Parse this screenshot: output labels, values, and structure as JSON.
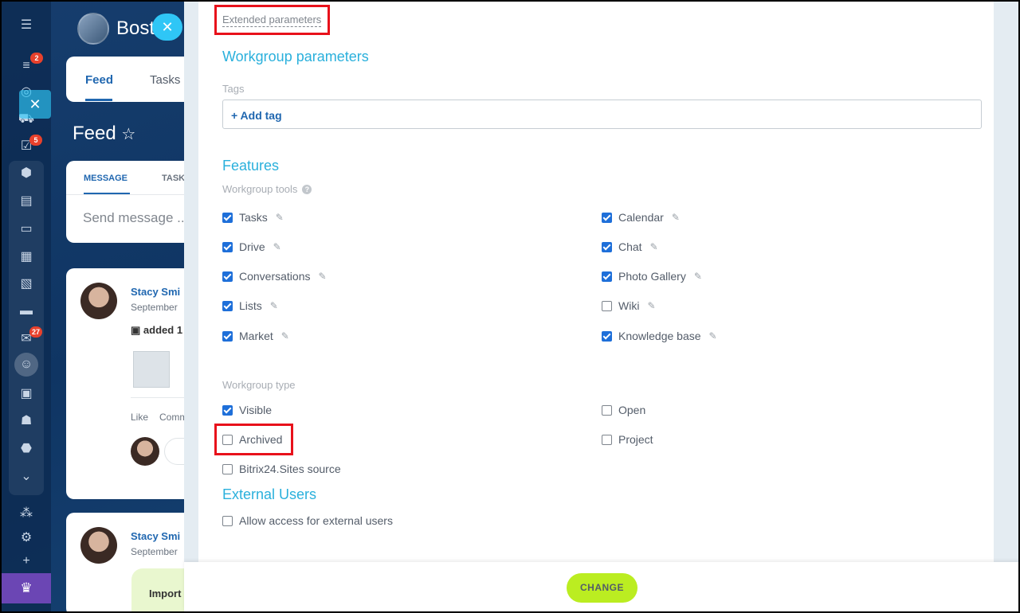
{
  "rail": {
    "badges": {
      "feed": "2",
      "tasks": "5",
      "mail": "27"
    }
  },
  "background": {
    "workgroup_title": "Bost",
    "tabs": {
      "feed": "Feed",
      "tasks": "Tasks"
    },
    "feed_title": "Feed",
    "composer": {
      "tab_message": "MESSAGE",
      "tab_task": "TASK",
      "placeholder": "Send message ..."
    },
    "posts": [
      {
        "author": "Stacy Smi",
        "date": "September",
        "action": "added 1",
        "footer_like": "Like",
        "footer_comment": "Comm"
      },
      {
        "author": "Stacy Smi",
        "date": "September",
        "snippet": "Import"
      }
    ]
  },
  "panel": {
    "extended_link": "Extended parameters",
    "workgroup_parameters": {
      "heading": "Workgroup parameters",
      "tags_label": "Tags",
      "add_tag": "+ Add tag"
    },
    "features": {
      "heading": "Features",
      "tools_label": "Workgroup tools",
      "left": [
        {
          "label": "Tasks",
          "checked": true
        },
        {
          "label": "Drive",
          "checked": true
        },
        {
          "label": "Conversations",
          "checked": true
        },
        {
          "label": "Lists",
          "checked": true
        },
        {
          "label": "Market",
          "checked": true
        }
      ],
      "right": [
        {
          "label": "Calendar",
          "checked": true
        },
        {
          "label": "Chat",
          "checked": true
        },
        {
          "label": "Photo Gallery",
          "checked": true
        },
        {
          "label": "Wiki",
          "checked": false
        },
        {
          "label": "Knowledge base",
          "checked": true
        }
      ]
    },
    "workgroup_type": {
      "label": "Workgroup type",
      "visible": {
        "label": "Visible",
        "checked": true
      },
      "open": {
        "label": "Open",
        "checked": false
      },
      "archived": {
        "label": "Archived",
        "checked": false
      },
      "project": {
        "label": "Project",
        "checked": false
      },
      "sites_source": {
        "label": "Bitrix24.Sites source",
        "checked": false
      }
    },
    "external_users": {
      "heading": "External Users",
      "allow": {
        "label": "Allow access for external users",
        "checked": false
      }
    }
  },
  "footer": {
    "change_button": "CHANGE"
  },
  "colors": {
    "accent": "#2ab0dc",
    "checkbox": "#1e6fd9",
    "button": "#bbed21",
    "highlight": "#e8111b"
  }
}
